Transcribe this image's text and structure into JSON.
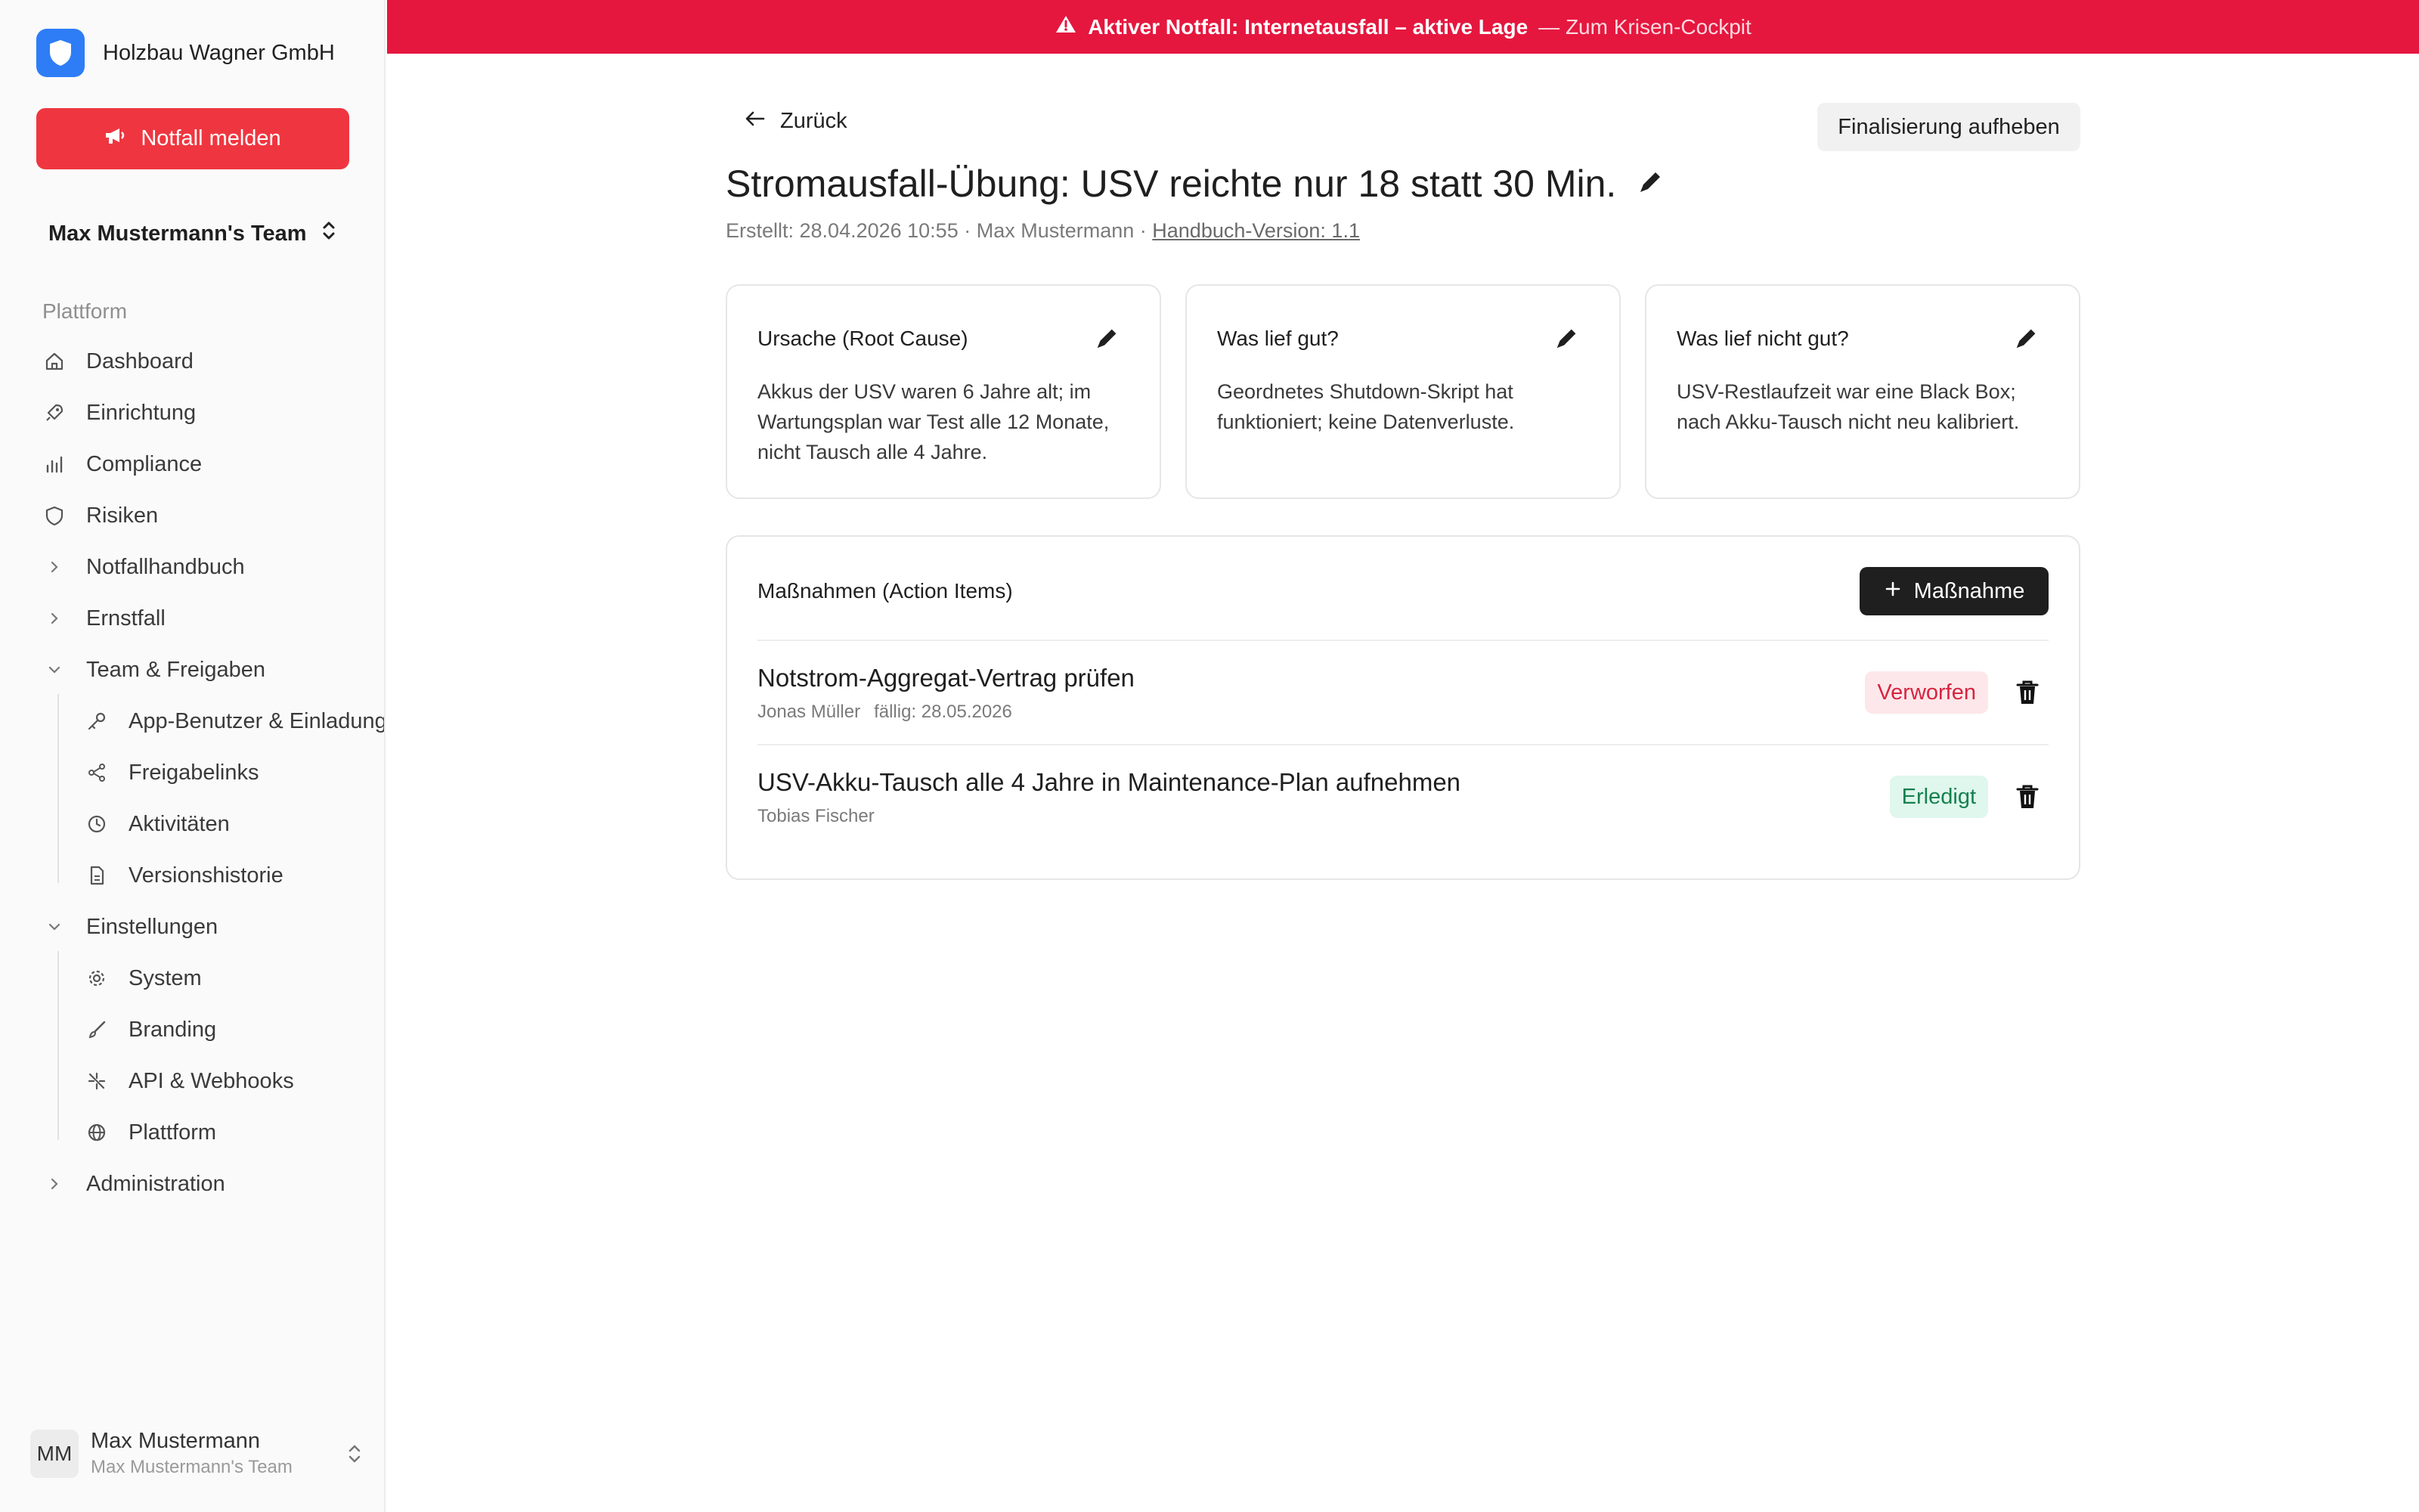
{
  "sidebar": {
    "org_name": "Holzbau Wagner GmbH",
    "emergency_button": "Notfall melden",
    "team_name": "Max Mustermann's Team",
    "section_label": "Plattform",
    "items": {
      "dashboard": "Dashboard",
      "einrichtung": "Einrichtung",
      "compliance": "Compliance",
      "risiken": "Risiken",
      "notfallhandbuch": "Notfallhandbuch",
      "ernstfall": "Ernstfall",
      "team_freigaben": "Team & Freigaben",
      "app_benutzer": "App-Benutzer & Einladungen",
      "freigabelinks": "Freigabelinks",
      "aktivitaeten": "Aktivitäten",
      "versionshistorie": "Versionshistorie",
      "einstellungen": "Einstellungen",
      "system": "System",
      "branding": "Branding",
      "api_webhooks": "API & Webhooks",
      "plattform": "Plattform",
      "administration": "Administration"
    },
    "user": {
      "initials": "MM",
      "name": "Max Mustermann",
      "team": "Max Mustermann's Team"
    }
  },
  "alert": {
    "text": "Aktiver Notfall: Internetausfall – aktive Lage",
    "link": "— Zum Krisen-Cockpit"
  },
  "header": {
    "back": "Zurück",
    "unfinalize": "Finalisierung aufheben",
    "title": "Stromausfall-Übung: USV reichte nur 18 statt 30 Min.",
    "meta_created": "Erstellt: 28.04.2026 10:55 · Max Mustermann · ",
    "meta_link": "Handbuch-Version: 1.1"
  },
  "cards": {
    "root_cause": {
      "title": "Ursache (Root Cause)",
      "body": "Akkus der USV waren 6 Jahre alt; im Wartungsplan war Test alle 12 Monate, nicht Tausch alle 4 Jahre."
    },
    "went_well": {
      "title": "Was lief gut?",
      "body": "Geordnetes Shutdown-Skript hat funktioniert; keine Datenverluste."
    },
    "went_wrong": {
      "title": "Was lief nicht gut?",
      "body": "USV-Restlaufzeit war eine Black Box; nach Akku-Tausch nicht neu kalibriert."
    }
  },
  "actions": {
    "title": "Maßnahmen (Action Items)",
    "add_button": "Maßnahme",
    "items": [
      {
        "title": "Notstrom-Aggregat-Vertrag prüfen",
        "owner": "Jonas Müller",
        "due": "fällig: 28.05.2026",
        "status": "Verworfen"
      },
      {
        "title": "USV-Akku-Tausch alle 4 Jahre in Maintenance-Plan aufnehmen",
        "owner": "Tobias Fischer",
        "due": "",
        "status": "Erledigt"
      }
    ]
  },
  "colors": {
    "alert_bg": "#e5173f",
    "emergency_btn": "#ef3640",
    "brand_blue": "#2e7df6",
    "badge_rejected_text": "#d6243f",
    "badge_done_text": "#16804f"
  }
}
